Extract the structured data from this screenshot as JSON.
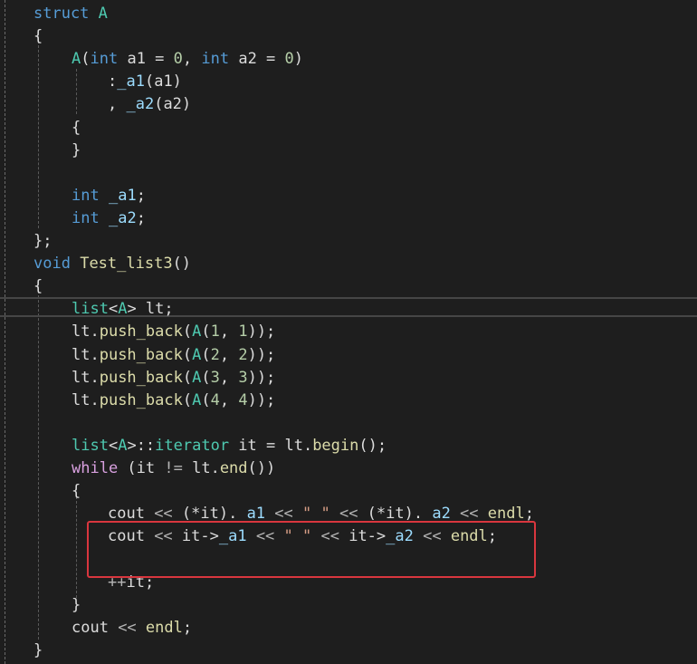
{
  "editor": {
    "lines": [
      {
        "tokens": [
          {
            "t": "struct ",
            "c": "kw"
          },
          {
            "t": "A",
            "c": "ty"
          }
        ]
      },
      {
        "tokens": [
          {
            "t": "{",
            "c": "pl"
          }
        ]
      },
      {
        "tokens": [
          {
            "t": "A",
            "c": "ty"
          },
          {
            "t": "(",
            "c": "pl"
          },
          {
            "t": "int",
            "c": "kw"
          },
          {
            "t": " a1 = ",
            "c": "pl"
          },
          {
            "t": "0",
            "c": "num"
          },
          {
            "t": ", ",
            "c": "pl"
          },
          {
            "t": "int",
            "c": "kw"
          },
          {
            "t": " a2 = ",
            "c": "pl"
          },
          {
            "t": "0",
            "c": "num"
          },
          {
            "t": ")",
            "c": "pl"
          }
        ]
      },
      {
        "tokens": [
          {
            "t": ":",
            "c": "pl"
          },
          {
            "t": "_a1",
            "c": "var"
          },
          {
            "t": "(a1)",
            "c": "pl"
          }
        ]
      },
      {
        "tokens": [
          {
            "t": ", ",
            "c": "pl"
          },
          {
            "t": "_a2",
            "c": "var"
          },
          {
            "t": "(a2)",
            "c": "pl"
          }
        ]
      },
      {
        "tokens": [
          {
            "t": "{",
            "c": "pl"
          }
        ]
      },
      {
        "tokens": [
          {
            "t": "}",
            "c": "pl"
          }
        ]
      },
      {
        "tokens": []
      },
      {
        "tokens": [
          {
            "t": "int",
            "c": "kw"
          },
          {
            "t": " ",
            "c": "pl"
          },
          {
            "t": "_a1",
            "c": "var"
          },
          {
            "t": ";",
            "c": "pl"
          }
        ]
      },
      {
        "tokens": [
          {
            "t": "int",
            "c": "kw"
          },
          {
            "t": " ",
            "c": "pl"
          },
          {
            "t": "_a2",
            "c": "var"
          },
          {
            "t": ";",
            "c": "pl"
          }
        ]
      },
      {
        "tokens": [
          {
            "t": "};",
            "c": "pl"
          }
        ]
      },
      {
        "tokens": [
          {
            "t": "void",
            "c": "kw"
          },
          {
            "t": " ",
            "c": "pl"
          },
          {
            "t": "Test_list3",
            "c": "fn"
          },
          {
            "t": "()",
            "c": "pl"
          }
        ]
      },
      {
        "tokens": [
          {
            "t": "{",
            "c": "pl"
          }
        ]
      },
      {
        "tokens": [
          {
            "t": "list",
            "c": "ty"
          },
          {
            "t": "<",
            "c": "pl"
          },
          {
            "t": "A",
            "c": "ty"
          },
          {
            "t": "> lt;",
            "c": "pl"
          }
        ]
      },
      {
        "tokens": [
          {
            "t": "lt.",
            "c": "pl"
          },
          {
            "t": "push_back",
            "c": "fn"
          },
          {
            "t": "(",
            "c": "pl"
          },
          {
            "t": "A",
            "c": "ty"
          },
          {
            "t": "(",
            "c": "pl"
          },
          {
            "t": "1",
            "c": "num"
          },
          {
            "t": ", ",
            "c": "pl"
          },
          {
            "t": "1",
            "c": "num"
          },
          {
            "t": "));",
            "c": "pl"
          }
        ]
      },
      {
        "tokens": [
          {
            "t": "lt.",
            "c": "pl"
          },
          {
            "t": "push_back",
            "c": "fn"
          },
          {
            "t": "(",
            "c": "pl"
          },
          {
            "t": "A",
            "c": "ty"
          },
          {
            "t": "(",
            "c": "pl"
          },
          {
            "t": "2",
            "c": "num"
          },
          {
            "t": ", ",
            "c": "pl"
          },
          {
            "t": "2",
            "c": "num"
          },
          {
            "t": "));",
            "c": "pl"
          }
        ]
      },
      {
        "tokens": [
          {
            "t": "lt.",
            "c": "pl"
          },
          {
            "t": "push_back",
            "c": "fn"
          },
          {
            "t": "(",
            "c": "pl"
          },
          {
            "t": "A",
            "c": "ty"
          },
          {
            "t": "(",
            "c": "pl"
          },
          {
            "t": "3",
            "c": "num"
          },
          {
            "t": ", ",
            "c": "pl"
          },
          {
            "t": "3",
            "c": "num"
          },
          {
            "t": "));",
            "c": "pl"
          }
        ]
      },
      {
        "tokens": [
          {
            "t": "lt.",
            "c": "pl"
          },
          {
            "t": "push_back",
            "c": "fn"
          },
          {
            "t": "(",
            "c": "pl"
          },
          {
            "t": "A",
            "c": "ty"
          },
          {
            "t": "(",
            "c": "pl"
          },
          {
            "t": "4",
            "c": "num"
          },
          {
            "t": ", ",
            "c": "pl"
          },
          {
            "t": "4",
            "c": "num"
          },
          {
            "t": "));",
            "c": "pl"
          }
        ]
      },
      {
        "tokens": []
      },
      {
        "tokens": [
          {
            "t": "list",
            "c": "ty"
          },
          {
            "t": "<",
            "c": "pl"
          },
          {
            "t": "A",
            "c": "ty"
          },
          {
            "t": ">::",
            "c": "pl"
          },
          {
            "t": "iterator",
            "c": "ty"
          },
          {
            "t": " it = lt.",
            "c": "pl"
          },
          {
            "t": "begin",
            "c": "fn"
          },
          {
            "t": "();",
            "c": "pl"
          }
        ]
      },
      {
        "tokens": [
          {
            "t": "while",
            "c": "ctrl"
          },
          {
            "t": " (it ",
            "c": "pl"
          },
          {
            "t": "!=",
            "c": "op"
          },
          {
            "t": " lt.",
            "c": "pl"
          },
          {
            "t": "end",
            "c": "fn"
          },
          {
            "t": "())",
            "c": "pl"
          }
        ]
      },
      {
        "tokens": [
          {
            "t": "{",
            "c": "pl"
          }
        ]
      },
      {
        "tokens": [
          {
            "t": "cout",
            "c": "pl"
          },
          {
            "t": " << ",
            "c": "op"
          },
          {
            "t": "(*it).",
            "c": "pl"
          },
          {
            "t": "_a1",
            "c": "var"
          },
          {
            "t": " << ",
            "c": "op"
          },
          {
            "t": "\" \"",
            "c": "str"
          },
          {
            "t": " << ",
            "c": "op"
          },
          {
            "t": "(*it).",
            "c": "pl"
          },
          {
            "t": "_a2",
            "c": "var"
          },
          {
            "t": " << ",
            "c": "op"
          },
          {
            "t": "endl",
            "c": "fn"
          },
          {
            "t": ";",
            "c": "pl"
          }
        ]
      },
      {
        "tokens": [
          {
            "t": "cout",
            "c": "pl"
          },
          {
            "t": " << ",
            "c": "op"
          },
          {
            "t": "it->",
            "c": "pl"
          },
          {
            "t": "_a1",
            "c": "var"
          },
          {
            "t": " << ",
            "c": "op"
          },
          {
            "t": "\" \"",
            "c": "str"
          },
          {
            "t": " << ",
            "c": "op"
          },
          {
            "t": "it->",
            "c": "pl"
          },
          {
            "t": "_a2",
            "c": "var"
          },
          {
            "t": " << ",
            "c": "op"
          },
          {
            "t": "endl",
            "c": "fn"
          },
          {
            "t": ";",
            "c": "pl"
          }
        ]
      },
      {
        "tokens": []
      },
      {
        "tokens": [
          {
            "t": "++",
            "c": "op"
          },
          {
            "t": "it;",
            "c": "pl"
          }
        ]
      },
      {
        "tokens": [
          {
            "t": "}",
            "c": "pl"
          }
        ]
      },
      {
        "tokens": [
          {
            "t": "cout",
            "c": "pl"
          },
          {
            "t": " << ",
            "c": "op"
          },
          {
            "t": "endl",
            "c": "fn"
          },
          {
            "t": ";",
            "c": "pl"
          }
        ]
      },
      {
        "tokens": [
          {
            "t": "}",
            "c": "pl"
          }
        ]
      }
    ]
  },
  "colors": {
    "background": "#1e1e1e",
    "keyword": "#569cd6",
    "type": "#4ec9b0",
    "function": "#dcdcaa",
    "member": "#9cdcfe",
    "number": "#b5cea8",
    "string": "#d69d85",
    "control": "#d8a0df",
    "annotation_box": "#d9363e"
  }
}
